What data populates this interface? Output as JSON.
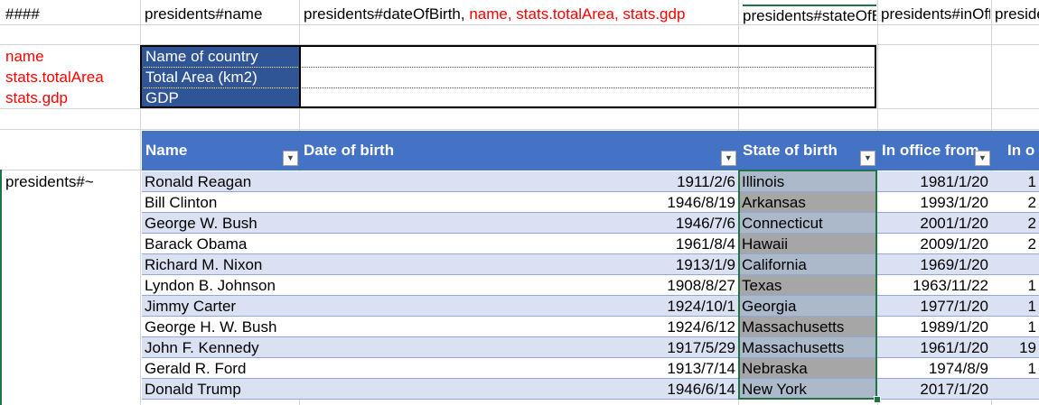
{
  "header_row": {
    "a": "####",
    "b": "presidents#name",
    "c_black": "presidents#dateOfBirth,",
    "c_red": " name, stats.totalArea, stats.gdp",
    "d": "presidents#stateOfBirth",
    "e": "presidents#inOffice",
    "f": "presidents#"
  },
  "side_labels": [
    "name",
    "stats.totalArea",
    "stats.gdp"
  ],
  "info_box": {
    "labels": [
      "Name of country",
      "Total Area (km2)",
      "GDP"
    ]
  },
  "list_marker": "presidents#~",
  "table": {
    "headers": [
      "Name",
      "Date of birth",
      "State of birth",
      "In office from",
      "In o"
    ],
    "rows": [
      {
        "name": "Ronald Reagan",
        "dob": "1911/2/6",
        "state": "Illinois",
        "from": "1981/1/20",
        "extra": "1"
      },
      {
        "name": "Bill Clinton",
        "dob": "1946/8/19",
        "state": "Arkansas",
        "from": "1993/1/20",
        "extra": "2"
      },
      {
        "name": "George W. Bush",
        "dob": "1946/7/6",
        "state": "Connecticut",
        "from": "2001/1/20",
        "extra": "2"
      },
      {
        "name": "Barack Obama",
        "dob": "1961/8/4",
        "state": "Hawaii",
        "from": "2009/1/20",
        "extra": "2"
      },
      {
        "name": "Richard M. Nixon",
        "dob": "1913/1/9",
        "state": "California",
        "from": "1969/1/20",
        "extra": ""
      },
      {
        "name": "Lyndon B. Johnson",
        "dob": "1908/8/27",
        "state": "Texas",
        "from": "1963/11/22",
        "extra": "1"
      },
      {
        "name": "Jimmy Carter",
        "dob": "1924/10/1",
        "state": "Georgia",
        "from": "1977/1/20",
        "extra": "1"
      },
      {
        "name": "George H. W. Bush",
        "dob": "1924/6/12",
        "state": "Massachusetts",
        "from": "1989/1/20",
        "extra": "1"
      },
      {
        "name": "John F. Kennedy",
        "dob": "1917/5/29",
        "state": "Massachusetts",
        "from": "1961/1/20",
        "extra": "19"
      },
      {
        "name": "Gerald R. Ford",
        "dob": "1913/7/14",
        "state": "Nebraska",
        "from": "1974/8/9",
        "extra": "1"
      },
      {
        "name": "Donald Trump",
        "dob": "1946/6/14",
        "state": "New York",
        "from": "2017/1/20",
        "extra": ""
      }
    ]
  },
  "colors": {
    "header_blue": "#4472c4",
    "label_dark_blue": "#2f5597",
    "band": "#d9e1f2",
    "state_fill": "#a6a6a6",
    "selection_green": "#217346",
    "red_text": "#ff0000"
  },
  "icons": {
    "filter_dropdown": "chevron-down-icon"
  }
}
